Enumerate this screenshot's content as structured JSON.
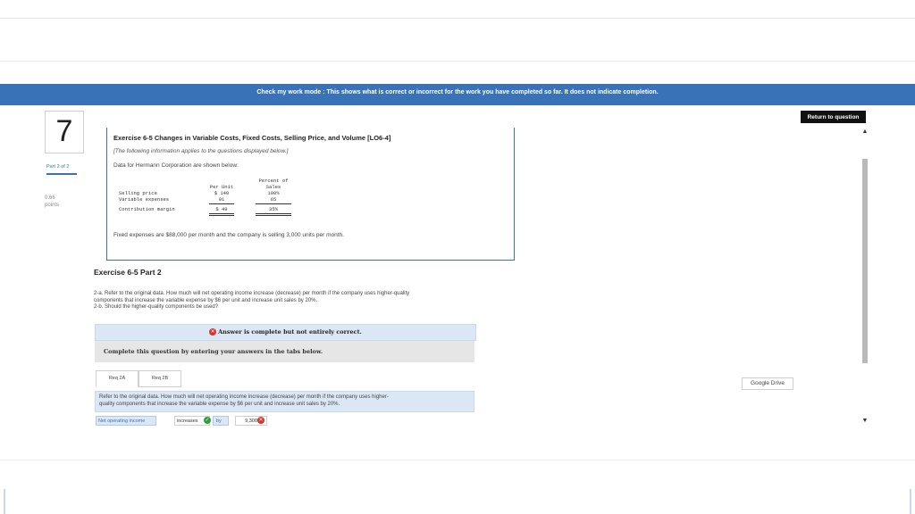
{
  "banner": {
    "text": "Check my work mode : This shows what is correct or incorrect for the work you have completed so far. It does not indicate completion."
  },
  "return_button": {
    "label": "Return to question"
  },
  "question": {
    "number": "7",
    "part_label": "Part 2 of 2",
    "points_value": "0.66",
    "points_label": "points"
  },
  "exercise": {
    "title": "Exercise 6-5 Changes in Variable Costs, Fixed Costs, Selling Price, and Volume [LO6-4]",
    "note": "[The following information applies to the questions displayed below.]",
    "intro": "Data for Hermann Corporation are shown below:",
    "table": {
      "header_per_unit": "Per Unit",
      "header_percent_1": "Percent of",
      "header_percent_2": "Sales",
      "rows": [
        {
          "label": "Selling price",
          "per_unit": "$ 140",
          "percent": "100%"
        },
        {
          "label": "Variable expenses",
          "per_unit": "91",
          "percent": "65"
        },
        {
          "label": "Contribution margin",
          "per_unit": "$ 49",
          "percent": "35%"
        }
      ]
    },
    "fixed_expenses": "Fixed expenses are $88,000 per month and the company is selling 3,000 units per month."
  },
  "part": {
    "title": "Exercise 6-5 Part 2",
    "line_1": "2-a. Refer to the original data. How much will net operating income increase (decrease) per month if the company uses higher-quality",
    "line_2": "components that increase the variable expense by $6 per unit and increase unit sales by 20%.",
    "line_3": "2-b. Should the higher-quality components be used?"
  },
  "status": {
    "answer_banner": "Answer is complete but not entirely correct.",
    "complete_prompt": "Complete this question by entering your answers in the tabs below."
  },
  "tabs": [
    {
      "label": "Req 2A"
    },
    {
      "label": "Req 2B"
    }
  ],
  "req_description": {
    "line_1": "Refer to the original data. How much will net operating income increase (decrease) per month if the company uses higher-",
    "line_2": "quality components that increase the variable expense by $6 per unit and increase unit sales by 20%."
  },
  "answer_row": {
    "label": "Net operating income",
    "direction": "increases",
    "by_label": "by",
    "amount": "9,300"
  },
  "google_drive": {
    "label": "Google Drive"
  },
  "colors": {
    "banner": "#3a72b8",
    "correct": "#2e9d3c",
    "incorrect": "#d9342b",
    "highlight": "#dbe7f5"
  },
  "icons": {
    "correct": "check-circle-icon",
    "incorrect": "x-circle-icon",
    "scroll_up": "triangle-up-icon",
    "scroll_down": "triangle-down-icon"
  }
}
